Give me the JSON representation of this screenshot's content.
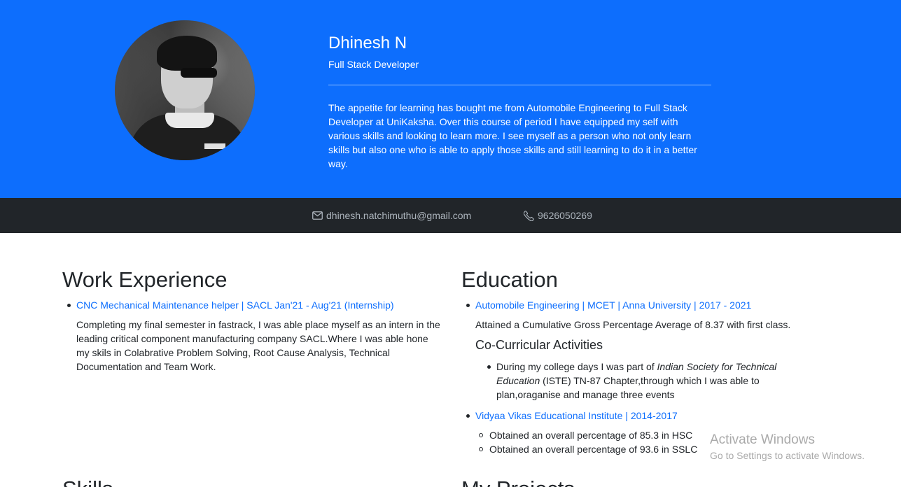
{
  "profile": {
    "name": "Dhinesh N",
    "role": "Full Stack Developer",
    "about": "The appetite for learning has bought me from Automobile Engineering to Full Stack Developer at UniKaksha. Over this course of period I have equipped my self with various skills and looking to learn more. I see myself as a person who not only learn skills but also one who is able to apply those skills and still learning to do it in a better way."
  },
  "contact": {
    "email": "dhinesh.natchimuthu@gmail.com",
    "phone": "9626050269",
    "email_icon": "envelope-icon",
    "phone_icon": "telephone-icon"
  },
  "work": {
    "title": "Work Experience",
    "items": [
      {
        "link": "CNC Mechanical Maintenance helper | SACL Jan'21 - Aug'21 (Internship)",
        "desc_lines": [
          "Completing my final semester in fastrack, I was able place myself as an intern in the",
          "leading critical component manufacturing company SACL.Where I was able hone",
          "my skils in Colabrative Problem Solving, Root Cause Analysis, Technical",
          "Documentation and Team Work."
        ]
      }
    ]
  },
  "education": {
    "title": "Education",
    "items": [
      {
        "link": "Automobile Engineering | MCET | Anna University | 2017 - 2021",
        "desc": "Attained a Cumulative Gross Percentage Average of 8.37 with first class.",
        "sub_title": "Co-Curricular Activities",
        "sub_line1_pre": "During my college days I was part of ",
        "sub_line1_em": "Indian Society for Technical",
        "sub_line2_em": "Education",
        "sub_line2_post": " (ISTE) TN-87 Chapter,through which I was able to",
        "sub_line3": "plan,oraganise and manage three events"
      },
      {
        "link": "Vidyaa Vikas Educational Institute | 2014-2017",
        "points": [
          "Obtained an overall percentage of 85.3 in HSC",
          "Obtained an overall percentage of 93.6 in SSLC"
        ]
      }
    ]
  },
  "next_sections": {
    "skills": "Skills",
    "projects": "My Projects"
  },
  "watermark": {
    "line1": "Activate Windows",
    "line2": "Go to Settings to activate Windows."
  },
  "colors": {
    "hero": "#0d6efd",
    "contact_bar": "#212529",
    "link": "#0d6efd"
  }
}
